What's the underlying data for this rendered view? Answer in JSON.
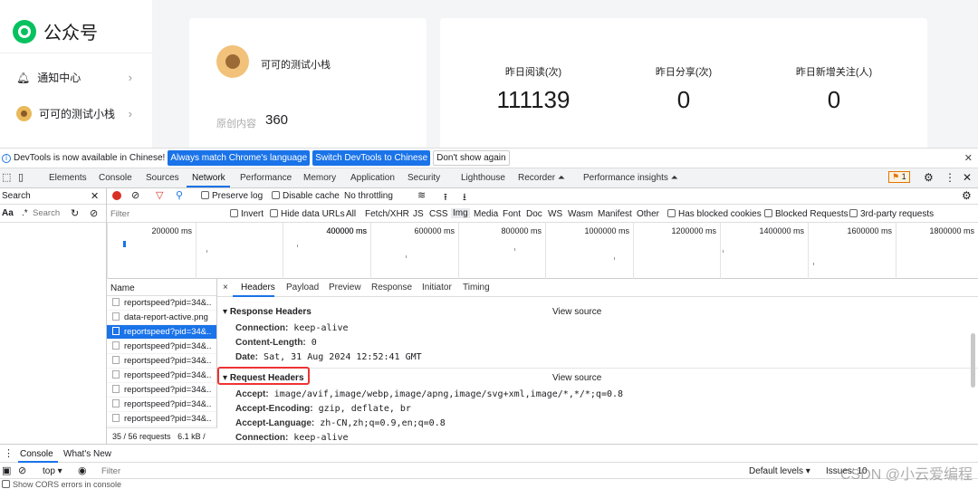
{
  "app": {
    "brand": "公众号"
  },
  "sidebar": {
    "items": [
      {
        "label": "通知中心",
        "icon": "bell-icon"
      },
      {
        "label": "可可的测试小栈",
        "icon": "avatar"
      }
    ]
  },
  "account": {
    "name": "可可的测试小栈",
    "original_label": "原创内容",
    "original_count": "360"
  },
  "stats": [
    {
      "label": "昨日阅读(次)",
      "value": "111139"
    },
    {
      "label": "昨日分享(次)",
      "value": "0"
    },
    {
      "label": "昨日新增关注(人)",
      "value": "0"
    }
  ],
  "infobar": {
    "message": "DevTools is now available in Chinese!",
    "btn_match": "Always match Chrome's language",
    "btn_switch": "Switch DevTools to Chinese",
    "btn_dont": "Don't show again"
  },
  "devtools_tabs": [
    "Elements",
    "Console",
    "Sources",
    "Network",
    "Performance",
    "Memory",
    "Application",
    "Security",
    "Lighthouse",
    "Recorder ⏶",
    "Performance insights ⏶"
  ],
  "active_tab": "Network",
  "issues_count": "1",
  "search_pane": {
    "title": "Search",
    "aa": "Aa",
    "regex": ".*",
    "placeholder": "Search"
  },
  "network_toolbar": {
    "preserve_log": "Preserve log",
    "disable_cache": "Disable cache",
    "throttling": "No throttling",
    "filter_placeholder": "Filter",
    "invert": "Invert",
    "hide_data_urls": "Hide data URLs",
    "types": [
      "All",
      "Fetch/XHR",
      "JS",
      "CSS",
      "Img",
      "Media",
      "Font",
      "Doc",
      "WS",
      "Wasm",
      "Manifest",
      "Other"
    ],
    "selected_type": "Img",
    "blocked_cookies": "Has blocked cookies",
    "blocked_requests": "Blocked Requests",
    "third_party": "3rd-party requests"
  },
  "timeline": {
    "ticks": [
      "200000 ms",
      "400000 ms",
      "600000 ms",
      "800000 ms",
      "1000000 ms",
      "1200000 ms",
      "1400000 ms",
      "1600000 ms",
      "1800000 ms",
      "2000000 m"
    ]
  },
  "request_list": {
    "header": "Name",
    "items": [
      {
        "name": "reportspeed?pid=34&..",
        "selected": false
      },
      {
        "name": "data-report-active.png",
        "selected": false
      },
      {
        "name": "reportspeed?pid=34&..",
        "selected": true
      },
      {
        "name": "reportspeed?pid=34&..",
        "selected": false
      },
      {
        "name": "reportspeed?pid=34&..",
        "selected": false
      },
      {
        "name": "reportspeed?pid=34&..",
        "selected": false
      },
      {
        "name": "reportspeed?pid=34&..",
        "selected": false
      },
      {
        "name": "reportspeed?pid=34&..",
        "selected": false
      },
      {
        "name": "reportspeed?pid=34&..",
        "selected": false
      }
    ],
    "status": "35 / 56 requests",
    "size": "6.1 kB /"
  },
  "detail": {
    "close": "×",
    "tabs": [
      "Headers",
      "Payload",
      "Preview",
      "Response",
      "Initiator",
      "Timing"
    ],
    "active_tab": "Headers",
    "response_headers_title": "Response Headers",
    "view_source": "View source",
    "response_headers": [
      {
        "k": "Connection:",
        "v": "keep-alive"
      },
      {
        "k": "Content-Length:",
        "v": "0"
      },
      {
        "k": "Date:",
        "v": "Sat, 31 Aug 2024 12:52:41 GMT"
      }
    ],
    "request_headers_title": "Request Headers",
    "request_headers": [
      {
        "k": "Accept:",
        "v": "image/avif,image/webp,image/apng,image/svg+xml,image/*,*/*;q=0.8"
      },
      {
        "k": "Accept-Encoding:",
        "v": "gzip, deflate, br"
      },
      {
        "k": "Accept-Language:",
        "v": "zh-CN,zh;q=0.9,en;q=0.8"
      },
      {
        "k": "Connection:",
        "v": "keep-alive"
      }
    ]
  },
  "drawer": {
    "tabs": [
      "Console",
      "What's New"
    ],
    "context": "top ▾",
    "filter_placeholder": "Filter",
    "levels": "Default levels ▾",
    "issues": "Issues: ",
    "issues_count": "10",
    "cors": "Show CORS errors in console"
  },
  "watermark": "CSDN @小云爱编程"
}
